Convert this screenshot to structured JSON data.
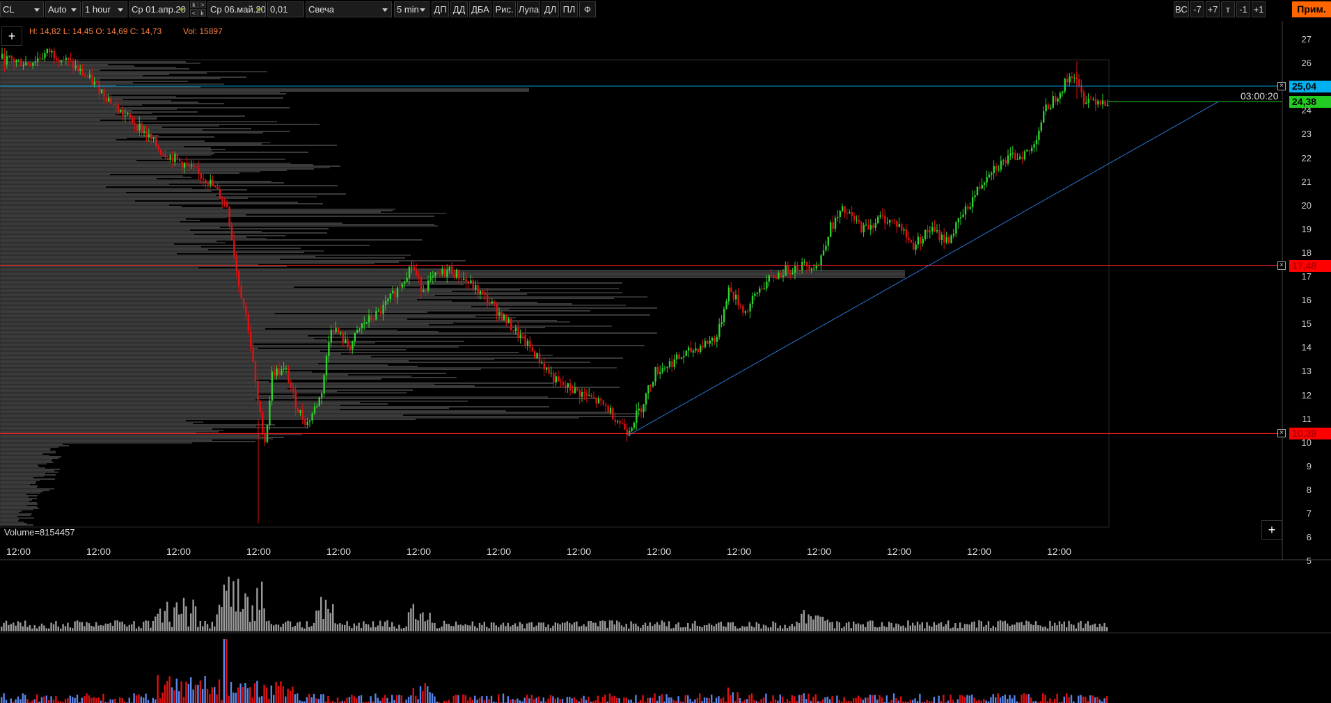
{
  "toolbar": {
    "symbol": "CL",
    "scale": "Auto",
    "timeframe": "1 hour",
    "date_from": "Ср 01.апр.20",
    "date_to": "Ср 06.май.20",
    "tick_size": "0,01",
    "chart_type": "Свеча",
    "subperiod": "5 min",
    "k_top": "k",
    "k_gt": ">",
    "k_lt": "<",
    "k_bottom": "k",
    "buttons": [
      "ДП",
      "ДД",
      "ДБА",
      "Рис.",
      "Лупа",
      "ДЛ",
      "ПЛ",
      "Ф"
    ],
    "right_buttons": [
      "ВС",
      "-7",
      "+7",
      "т",
      "-1",
      "+1"
    ],
    "prim": "Прим."
  },
  "info": {
    "ohlc": "H: 14,82  L: 14,45  O: 14,69  C: 14,73",
    "vol": "Vol: 15897"
  },
  "plus": "+",
  "volume_label": "Volume=8154457",
  "timer": "03:00:20",
  "y_axis": [
    "27",
    "26",
    "25",
    "24",
    "23",
    "22",
    "21",
    "20",
    "19",
    "18",
    "17",
    "16",
    "15",
    "14",
    "13",
    "12",
    "11",
    "10",
    "9",
    "8",
    "7",
    "6",
    "5"
  ],
  "x_axis": [
    "12:00",
    "12:00",
    "12:00",
    "12:00",
    "12:00",
    "12:00",
    "12:00",
    "12:00",
    "12:00",
    "12:00",
    "12:00",
    "12:00",
    "12:00",
    "12:00"
  ],
  "levels": [
    {
      "label": "25,04",
      "color": "#00b0f0",
      "text_color": "#000"
    },
    {
      "label": "24,38",
      "color": "#22cc22",
      "text_color": "#000"
    },
    {
      "label": "17,48",
      "color": "#ff0000",
      "text_color": "#ff3333"
    },
    {
      "label": "10,39",
      "color": "#ff0000",
      "text_color": "#ff3333"
    }
  ],
  "close_icon": "×",
  "colors": {
    "up": "#2fd12f",
    "down": "#e01010",
    "profile": "#3a3a3a",
    "vol_gray": "#9a9a9a",
    "vol_red": "#e01010",
    "vol_blue": "#5a86e8"
  }
}
